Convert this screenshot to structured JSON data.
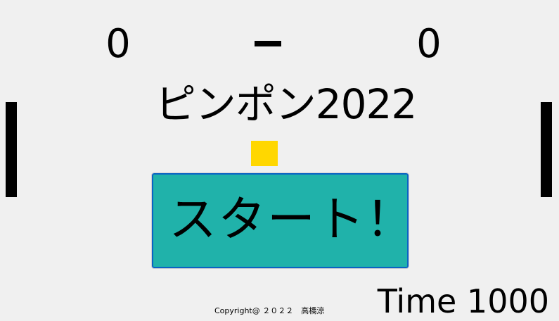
{
  "scoreboard": {
    "left_score": "0",
    "right_score": "0"
  },
  "title": "ピンポン2022",
  "start_button": {
    "label": "スタート！",
    "color": "#20b2aa"
  },
  "ball": {
    "color": "#ffd700"
  },
  "paddle": {
    "color": "#000000"
  },
  "footer": {
    "copyright": "Copyright@ ２０２２　高橋涼"
  },
  "timer": {
    "text": "Time 1000"
  }
}
